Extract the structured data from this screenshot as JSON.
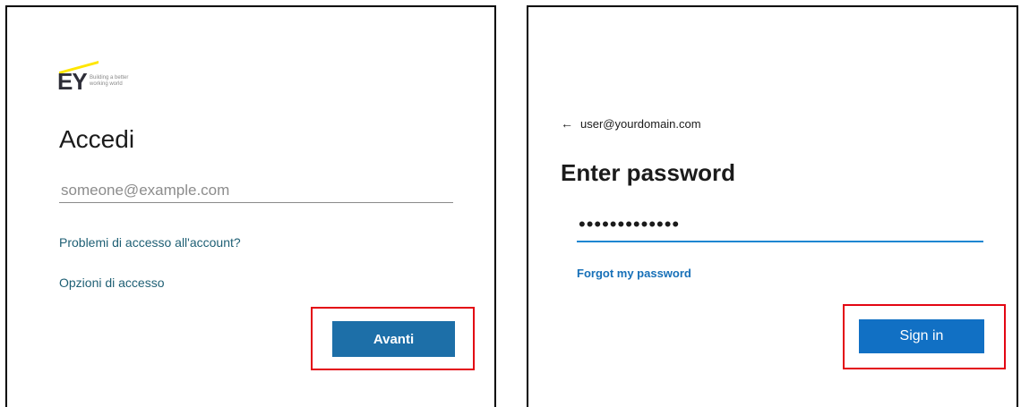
{
  "left": {
    "logo": {
      "letters": "EY",
      "tagline": "Building a better working world",
      "accent_color": "#ffe600"
    },
    "title": "Accedi",
    "email_placeholder": "someone@example.com",
    "link_problems": "Problemi di accesso all'account?",
    "link_options": "Opzioni di accesso",
    "next_button": "Avanti"
  },
  "right": {
    "back_arrow": "←",
    "account": "user@yourdomain.com",
    "title": "Enter password",
    "password_mask": "•••••••••••••",
    "forgot_link": "Forgot my password",
    "signin_button": "Sign in"
  },
  "colors": {
    "highlight": "#e30613",
    "button": "#1d6fa8",
    "focus_underline": "#1c86d1"
  },
  "icons": {
    "back": "back-arrow-icon"
  }
}
